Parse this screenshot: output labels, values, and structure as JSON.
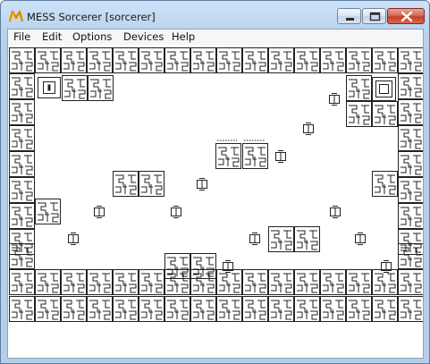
{
  "window": {
    "title": "MESS Sorcerer [sorcerer]",
    "app_icon": "m-logo-icon",
    "controls": [
      "minimize-icon",
      "maximize-icon",
      "close-icon"
    ]
  },
  "menu": [
    {
      "label": "File"
    },
    {
      "label": "Edit"
    },
    {
      "label": "Options"
    },
    {
      "label": "Devices"
    },
    {
      "label": "Help"
    }
  ],
  "colors": {
    "title_bar": "#bcd5ef",
    "close_button": "#c2412a",
    "screen_background": "#ffffff",
    "tile_ink": "#222222"
  },
  "board": {
    "description_icons": [
      "brick-tile-icon",
      "block-2x2-icon",
      "small-block-icon",
      "switch-icon",
      "panel-icon"
    ]
  }
}
